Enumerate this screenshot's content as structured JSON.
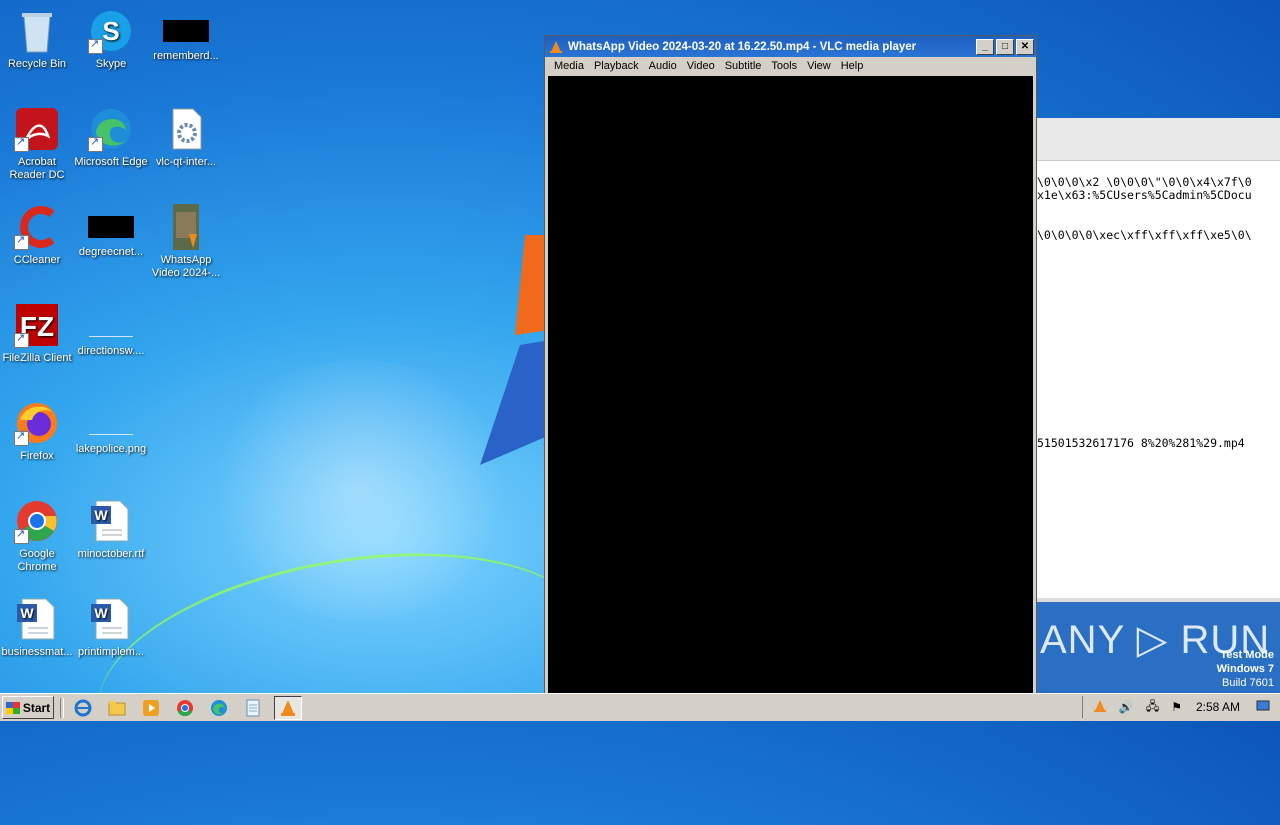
{
  "desktop_icons": [
    {
      "label": "Recycle Bin",
      "icon": "recycle-bin-icon"
    },
    {
      "label": "Skype",
      "icon": "skype-icon"
    },
    {
      "label": "rememberd...",
      "icon": "redacted-file-icon"
    },
    {
      "label": "Acrobat Reader DC",
      "icon": "acrobat-icon"
    },
    {
      "label": "Microsoft Edge",
      "icon": "edge-icon"
    },
    {
      "label": "vlc-qt-inter...",
      "icon": "config-file-icon"
    },
    {
      "label": "CCleaner",
      "icon": "ccleaner-icon"
    },
    {
      "label": "degreecnet...",
      "icon": "redacted-file-icon"
    },
    {
      "label": "WhatsApp Video 2024-...",
      "icon": "video-file-icon"
    },
    {
      "label": "FileZilla Client",
      "icon": "filezilla-icon"
    },
    {
      "label": "directionsw....",
      "icon": "png-file-icon"
    },
    {
      "label": "Firefox",
      "icon": "firefox-icon"
    },
    {
      "label": "lakepolice.png",
      "icon": "png-file-icon"
    },
    {
      "label": "Google Chrome",
      "icon": "chrome-icon"
    },
    {
      "label": "minoctober.rtf",
      "icon": "word-doc-icon"
    },
    {
      "label": "businessmat...",
      "icon": "word-doc-icon"
    },
    {
      "label": "printimplem...",
      "icon": "word-doc-icon"
    }
  ],
  "vlc": {
    "title": "WhatsApp Video 2024-03-20 at 16.22.50.mp4 - VLC media player",
    "menu": [
      "Media",
      "Playback",
      "Audio",
      "Video",
      "Subtitle",
      "Tools",
      "View",
      "Help"
    ]
  },
  "background_doc": {
    "lines": [
      "\\0\\0\\0\\x2 \\0\\0\\0\\\"\\0\\0\\x4\\x7f\\0",
      "x1e\\x63:%5CUsers%5Cadmin%5CDocu",
      "\\0\\0\\0\\0\\xec\\xff\\xff\\xff\\xe5\\0\\",
      "51501532617176 8%20%281%29.mp4"
    ]
  },
  "watermark": {
    "brand": "ANY ▷ RUN",
    "test_mode": "Test Mode",
    "os": "Windows 7",
    "build": "Build 7601"
  },
  "taskbar": {
    "start_label": "Start",
    "clock": "2:58 AM"
  }
}
